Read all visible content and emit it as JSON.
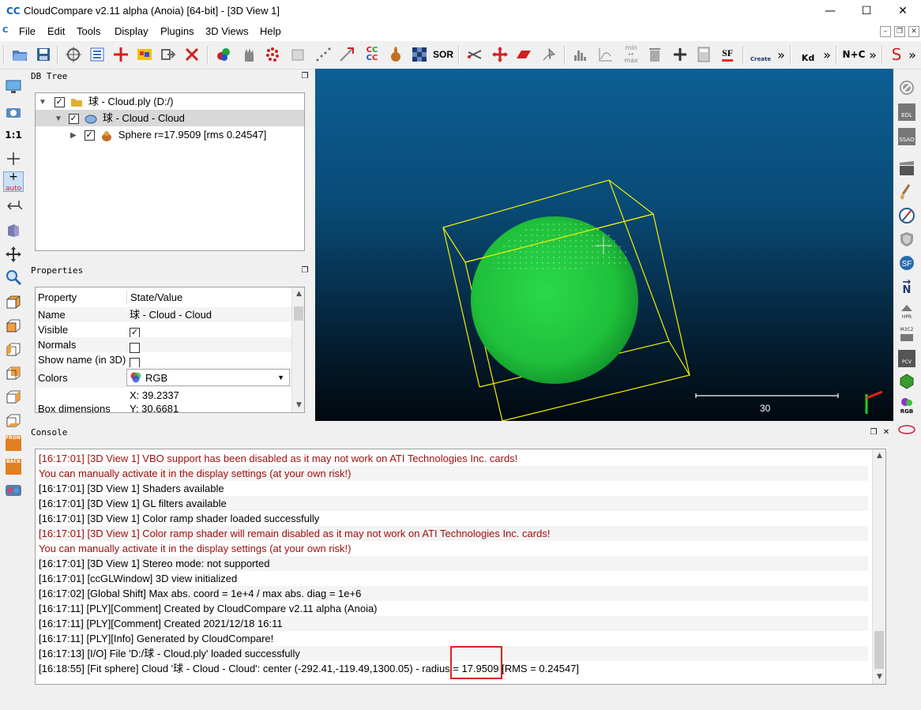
{
  "window": {
    "title": "CloudCompare v2.11 alpha (Anoia) [64-bit] - [3D View 1]",
    "logo": "CC",
    "minimize": "—",
    "maximize": "☐",
    "close": "✕"
  },
  "menu": {
    "items": [
      "File",
      "Edit",
      "Tools",
      "Display",
      "Plugins",
      "3D Views",
      "Help"
    ],
    "mdi_minimize": "–",
    "mdi_restore": "❐",
    "mdi_close": "✕"
  },
  "toolbar": {
    "sor_label": "SOR",
    "sf_label": "SF",
    "kd_label": "Kd",
    "nc_label": "N+C",
    "canupo_label": "Create",
    "more": "»"
  },
  "left_toolbar": {
    "one_to_one": "1:1",
    "auto": "auto",
    "front": "FRONT",
    "back": "BACK"
  },
  "right_toolbar": {
    "edl": "EDL",
    "ssao": "SSAO",
    "hpr": "HPR",
    "m3c2": "M3C2",
    "pcv": "PCV",
    "rgb": "RGB",
    "n": "N"
  },
  "db_tree": {
    "title": "DB Tree",
    "items": [
      {
        "label": "球 - Cloud.ply (D:/)",
        "checked": "✓"
      },
      {
        "label": "球 - Cloud - Cloud",
        "checked": "✓"
      },
      {
        "label": "Sphere r=17.9509 [rms 0.24547]",
        "checked": "✓"
      }
    ]
  },
  "properties": {
    "title": "Properties",
    "header": {
      "property": "Property",
      "value": "State/Value"
    },
    "rows": {
      "name": {
        "label": "Name",
        "value": "球 - Cloud - Cloud"
      },
      "visible": {
        "label": "Visible",
        "value": "✓"
      },
      "normals": {
        "label": "Normals",
        "value": ""
      },
      "show_name": {
        "label": "Show name (in 3D)",
        "value": ""
      },
      "colors": {
        "label": "Colors",
        "value": "RGB"
      },
      "box": {
        "label": "Box dimensions",
        "x": "X: 39.2337",
        "y": "Y: 30.6681"
      }
    }
  },
  "view3d": {
    "scale_label": "30"
  },
  "console": {
    "title": "Console",
    "lines": [
      {
        "text": "[16:17:01] [3D View 1] VBO support has been disabled as it may not work on ATI Technologies Inc. cards!",
        "level": "warn"
      },
      {
        "text": "You can manually activate it in the display settings (at your own risk!)",
        "level": "warn"
      },
      {
        "text": "[16:17:01] [3D View 1] Shaders available",
        "level": "info"
      },
      {
        "text": "[16:17:01] [3D View 1] GL filters available",
        "level": "info"
      },
      {
        "text": "[16:17:01] [3D View 1] Color ramp shader loaded successfully",
        "level": "info"
      },
      {
        "text": "[16:17:01] [3D View 1] Color ramp shader will remain disabled as it may not work on ATI Technologies Inc. cards!",
        "level": "warn"
      },
      {
        "text": "You can manually activate it in the display settings (at your own risk!)",
        "level": "warn"
      },
      {
        "text": "[16:17:01] [3D View 1] Stereo mode: not supported",
        "level": "info"
      },
      {
        "text": "[16:17:01] [ccGLWindow] 3D view initialized",
        "level": "info"
      },
      {
        "text": "[16:17:02] [Global Shift] Max abs. coord = 1e+4 / max abs. diag = 1e+6",
        "level": "info"
      },
      {
        "text": "[16:17:11] [PLY][Comment] Created by CloudCompare v2.11 alpha (Anoia)",
        "level": "info"
      },
      {
        "text": "[16:17:11] [PLY][Comment] Created 2021/12/18 16:11",
        "level": "info"
      },
      {
        "text": "[16:17:11] [PLY][Info] Generated by CloudCompare!",
        "level": "info"
      },
      {
        "text": "[16:17:13] [I/O] File 'D:/球 - Cloud.ply' loaded successfully",
        "level": "info"
      },
      {
        "text": "[16:18:55] [Fit sphere] Cloud '球 - Cloud - Cloud': center (-292.41,-119.49,1300.05) - radius = 17.9509 [RMS = 0.24547]",
        "level": "info"
      }
    ]
  },
  "colors": {
    "warning_text": "#a01010",
    "highlight_box": "#e02020",
    "bbox": "#f0f000",
    "sphere": "#2ad94a"
  }
}
